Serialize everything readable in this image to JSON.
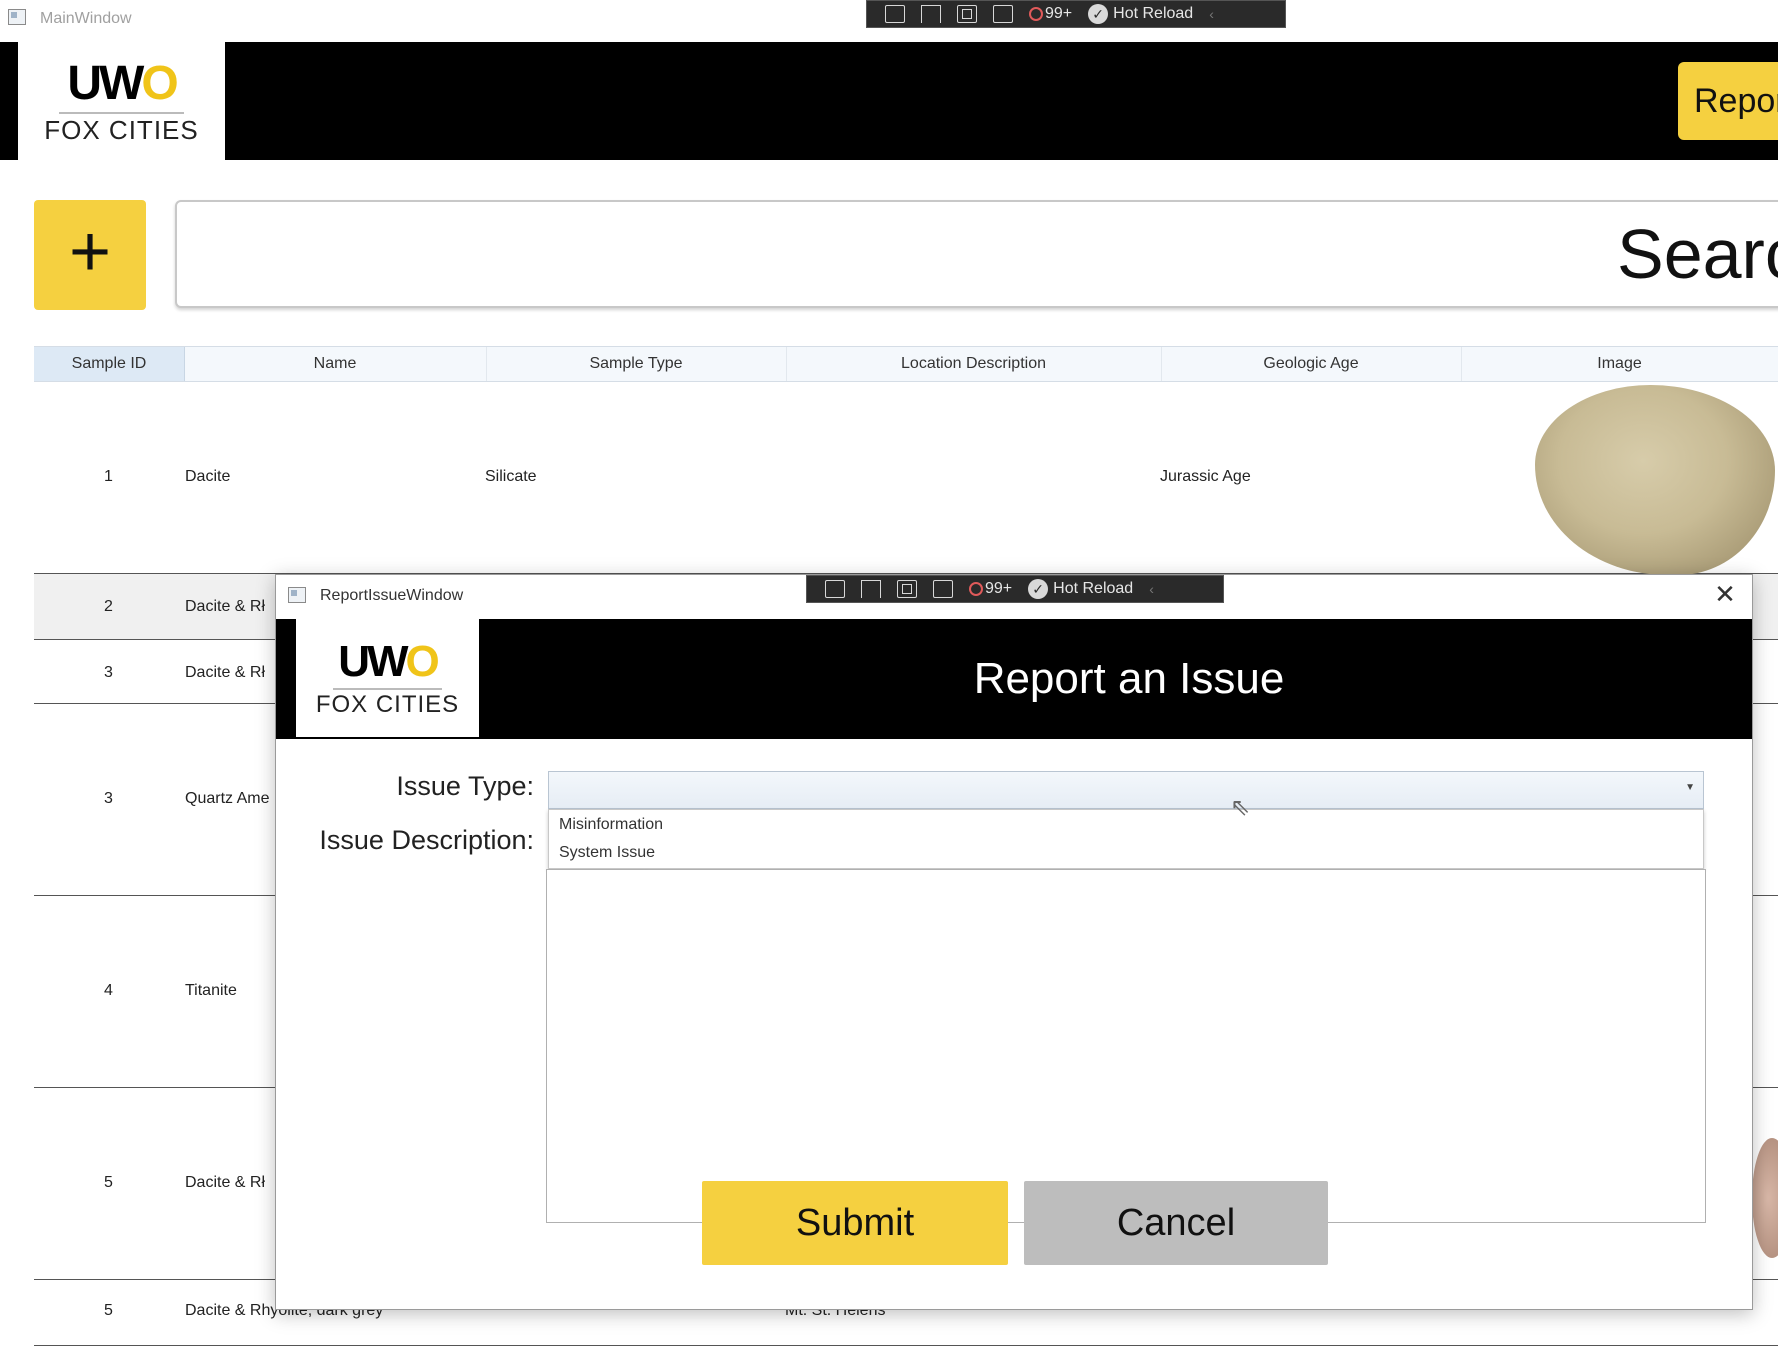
{
  "main_window": {
    "title": "MainWindow",
    "debug_toolbar": {
      "error_count": "99+",
      "hot_reload": "Hot Reload"
    },
    "logo": {
      "uwo_prefix": "UW",
      "uwo_o": "O",
      "campus": "FOX CITIES"
    },
    "report_button": "Repor",
    "add_button": "+",
    "search_text": "Searc"
  },
  "grid": {
    "columns": [
      "Sample ID",
      "Name",
      "Sample Type",
      "Location Description",
      "Geologic Age",
      "Image"
    ],
    "rows": [
      {
        "id": "1",
        "name": "Dacite",
        "type": "Silicate",
        "location": "",
        "age": "Jurassic Age"
      },
      {
        "id": "2",
        "name": "Dacite & Rł",
        "type": "",
        "location": "",
        "age": ""
      },
      {
        "id": "3",
        "name": "Dacite & Rł",
        "type": "",
        "location": "",
        "age": ""
      },
      {
        "id": "3",
        "name": "Quartz Ame",
        "type": "",
        "location": "",
        "age": ""
      },
      {
        "id": "4",
        "name": "Titanite",
        "type": "",
        "location": "",
        "age": ""
      },
      {
        "id": "5",
        "name": "Dacite & Rł",
        "type": "",
        "location": "",
        "age": ""
      },
      {
        "id": "5",
        "name": "Dacite & Rhyolite, dark grey",
        "type": "",
        "location": "Mt. St. Helens",
        "age": ""
      }
    ]
  },
  "dialog": {
    "title": "ReportIssueWindow",
    "debug_toolbar": {
      "error_count": "99+",
      "hot_reload": "Hot Reload"
    },
    "close": "✕",
    "heading": "Report an Issue",
    "issue_type_label": "Issue Type:",
    "issue_type_value": "",
    "issue_type_options": [
      "Misinformation",
      "System Issue"
    ],
    "issue_description_label": "Issue Description:",
    "issue_description_value": "",
    "submit": "Submit",
    "cancel": "Cancel"
  },
  "colors": {
    "brand_yellow": "#f5d040",
    "header_black": "#000000",
    "cancel_grey": "#bdbdbd"
  }
}
